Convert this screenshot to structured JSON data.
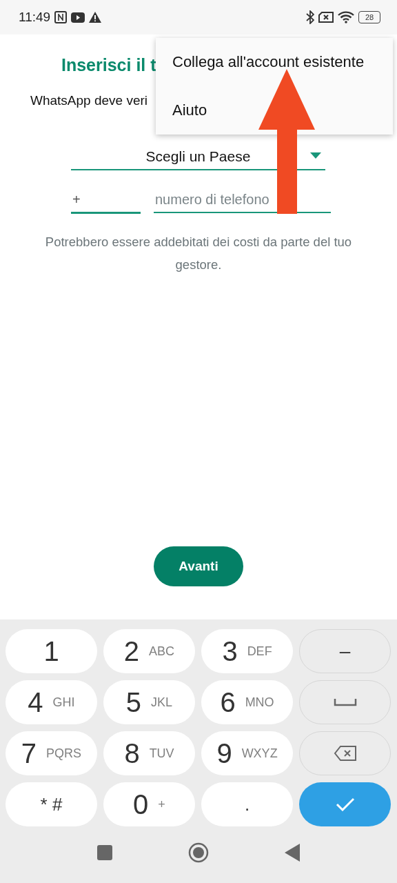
{
  "status_bar": {
    "time": "11:49",
    "battery": "28"
  },
  "title": "Inserisci il t",
  "description": "WhatsApp deve veri",
  "country_select": {
    "value": "Scegli un Paese"
  },
  "phone": {
    "country_code": {
      "value": "+",
      "focused": true
    },
    "number": {
      "placeholder": "numero di telefono",
      "focused": false
    }
  },
  "note": "Potrebbero essere addebitati dei costi da parte del tuo gestore.",
  "next_button": "Avanti",
  "menu": {
    "items": [
      {
        "label": "Collega all'account esistente"
      },
      {
        "label": "Aiuto"
      }
    ]
  },
  "keypad": {
    "keys": [
      {
        "kind": "digit",
        "label": "1"
      },
      {
        "kind": "digit",
        "label": "2",
        "letters": "ABC"
      },
      {
        "kind": "digit",
        "label": "3",
        "letters": "DEF"
      },
      {
        "kind": "dash",
        "label": "–"
      },
      {
        "kind": "digit",
        "label": "4",
        "letters": "GHI"
      },
      {
        "kind": "digit",
        "label": "5",
        "letters": "JKL"
      },
      {
        "kind": "digit",
        "label": "6",
        "letters": "MNO"
      },
      {
        "kind": "space"
      },
      {
        "kind": "digit",
        "label": "7",
        "letters": "PQRS"
      },
      {
        "kind": "digit",
        "label": "8",
        "letters": "TUV"
      },
      {
        "kind": "digit",
        "label": "9",
        "letters": "WXYZ"
      },
      {
        "kind": "backspace"
      },
      {
        "kind": "symbol",
        "label": "* #"
      },
      {
        "kind": "digit",
        "label": "0",
        "letters": "+"
      },
      {
        "kind": "symbol",
        "label": "."
      },
      {
        "kind": "confirm"
      }
    ]
  }
}
